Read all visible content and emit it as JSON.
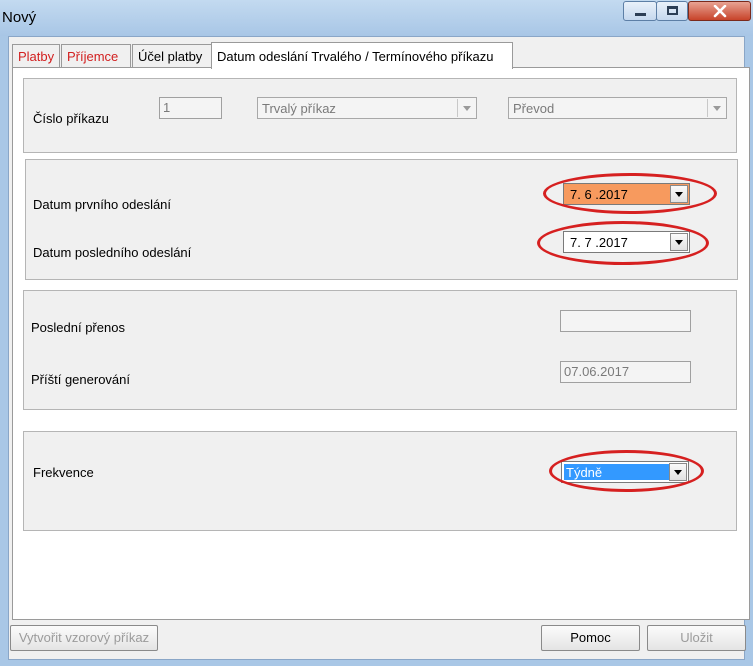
{
  "window": {
    "title": "Nový"
  },
  "tabs": [
    {
      "label": "Platby",
      "color": "#d21f1f"
    },
    {
      "label": "Příjemce",
      "color": "#d21f1f"
    },
    {
      "label": "Účel platby",
      "color": "#000000"
    },
    {
      "label": "Datum odeslání Trvalého / Termínového příkazu",
      "color": "#000000",
      "active": true
    }
  ],
  "order": {
    "label": "Číslo příkazu",
    "number": "1",
    "type_value": "Trvalý příkaz",
    "kind_value": "Převod"
  },
  "dates": {
    "first_label": "Datum prvního odeslání",
    "first_value": "7. 6 .2017",
    "first_highlight": "#f79a5e",
    "last_label": "Datum posledního odeslání",
    "last_value": "7. 7 .2017"
  },
  "transfer": {
    "last_label": "Poslední přenos",
    "last_value": "",
    "next_label": "Příští generování",
    "next_value": "07.06.2017"
  },
  "frequency": {
    "label": "Frekvence",
    "value": "Týdně",
    "highlight": "#3399ff"
  },
  "buttons": {
    "template": "Vytvořit vzorový příkaz",
    "help": "Pomoc",
    "save": "Uložit"
  },
  "annotation_color": "#d62020"
}
